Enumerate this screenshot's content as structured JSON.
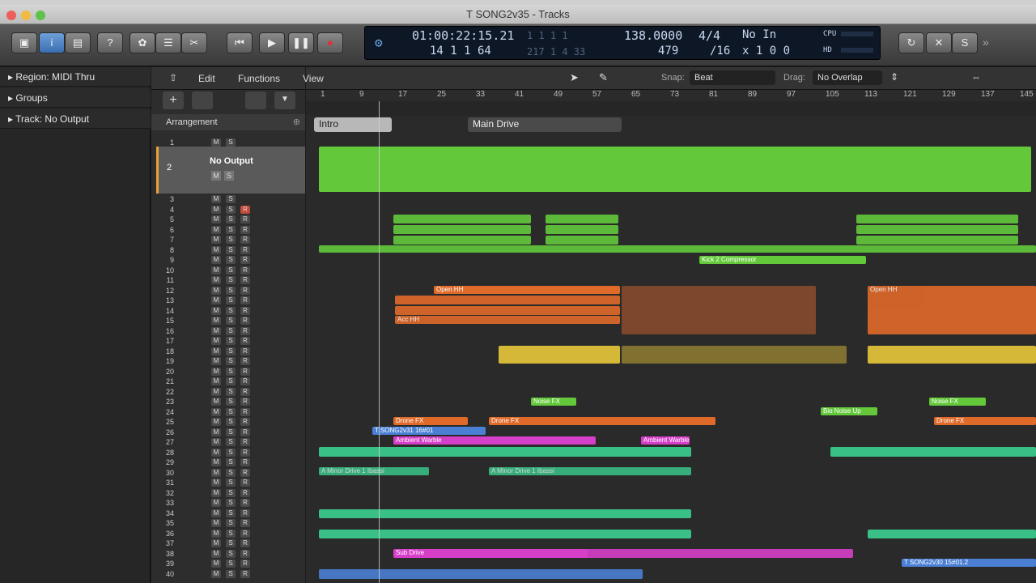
{
  "window": {
    "title": "T SONG2v35 - Tracks"
  },
  "toolbar": {
    "info_icon": "i",
    "help_icon": "?"
  },
  "lcd": {
    "position_smpte": "01:00:22:15.21",
    "position_bars": "1  1  1  1",
    "bars_secondary": "14  1  1  64",
    "end_bars": "217  1  4  33",
    "tempo": "138.0000",
    "tempo_secondary": "479",
    "timesig": "4/4",
    "division": "/16",
    "input_status": "No In",
    "key_status": "x 1  0  0",
    "cpu_label": "CPU",
    "hd_label": "HD"
  },
  "inspector": {
    "region": "Region: MIDI Thru",
    "groups": "Groups",
    "track": "Track:  No Output"
  },
  "edit_bar": {
    "edit": "Edit",
    "functions": "Functions",
    "view": "View",
    "snap_label": "Snap:",
    "snap_value": "Beat",
    "drag_label": "Drag:",
    "drag_value": "No Overlap"
  },
  "arrangement": {
    "label": "Arrangement",
    "sections": [
      "Intro",
      "Main Drive"
    ]
  },
  "ruler": {
    "marks": [
      "1",
      "9",
      "17",
      "25",
      "33",
      "41",
      "49",
      "57",
      "65",
      "73",
      "81",
      "89",
      "97",
      "105",
      "113",
      "121",
      "129",
      "137",
      "145"
    ]
  },
  "tracks": {
    "output_label": "No Output",
    "numbers": [
      "1",
      "2",
      "3",
      "4",
      "5",
      "6",
      "7",
      "8",
      "9",
      "10",
      "11",
      "12",
      "13",
      "14",
      "15",
      "16",
      "17",
      "18",
      "19",
      "20",
      "21",
      "22",
      "23",
      "24",
      "25",
      "26",
      "27",
      "28",
      "29",
      "30",
      "31",
      "32",
      "33",
      "34",
      "35",
      "36",
      "37",
      "38",
      "39",
      "40"
    ],
    "m": "M",
    "s": "S",
    "r": "R"
  },
  "regions": {
    "kick_comp": "Kick 2 Compressor",
    "open_hh": "Open HH",
    "acc_hh": "Acc HH",
    "drone_fx": "Drone FX",
    "ambient": "Ambient Warble",
    "a_minor": "A Minor Drive 1 Ibassi",
    "sub_drive": "Sub Drive",
    "noise_fx": "Noise FX",
    "bio_noise": "Bio Noise Up",
    "tsong": "T SONG2v31  16#01",
    "tsong2": "T SONG2v30  15#01.2"
  },
  "colors": {
    "green": "#63c93b",
    "orange": "#e06a2a",
    "yellow": "#e8c83a",
    "pink": "#d63fc8",
    "teal": "#3ad090",
    "blue": "#4a7fd4"
  }
}
